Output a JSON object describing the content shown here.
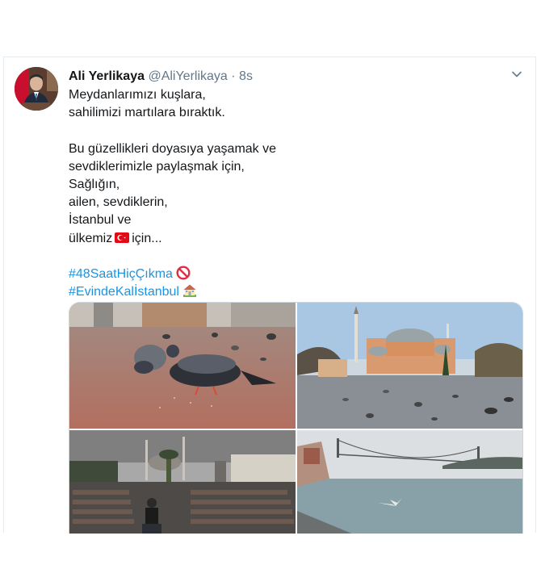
{
  "tweet": {
    "author_name": "Ali Yerlikaya",
    "author_handle": "@AliYerlikaya",
    "separator": "·",
    "timestamp": "8s",
    "lines": [
      "Meydanlarımızı kuşlara,",
      "sahilimizi martılara bıraktık.",
      "",
      "Bu güzellikleri doyasıya yaşamak ve",
      "sevdiklerimizle paylaşmak için,",
      "Sağlığın,",
      "ailen, sevdiklerin,",
      "İstanbul ve"
    ],
    "last_line_before_flag": "ülkemiz",
    "last_line_after_flag": "için...",
    "hashtags": [
      "#48SaatHiçÇıkma",
      "#EvindeKalİstanbul"
    ],
    "flag_emoji": "turkey-flag",
    "prohibited_emoji": "no-entry-sign",
    "house_emoji": "house-with-garden"
  },
  "colors": {
    "link": "#1b95e0",
    "text": "#14171a",
    "muted": "#657786",
    "border": "#e6ecf0"
  },
  "media": {
    "photos": [
      "pigeons-in-square",
      "hagia-sophia-square",
      "empty-park-with-mosque",
      "bosphorus-bridge-with-gull"
    ]
  }
}
